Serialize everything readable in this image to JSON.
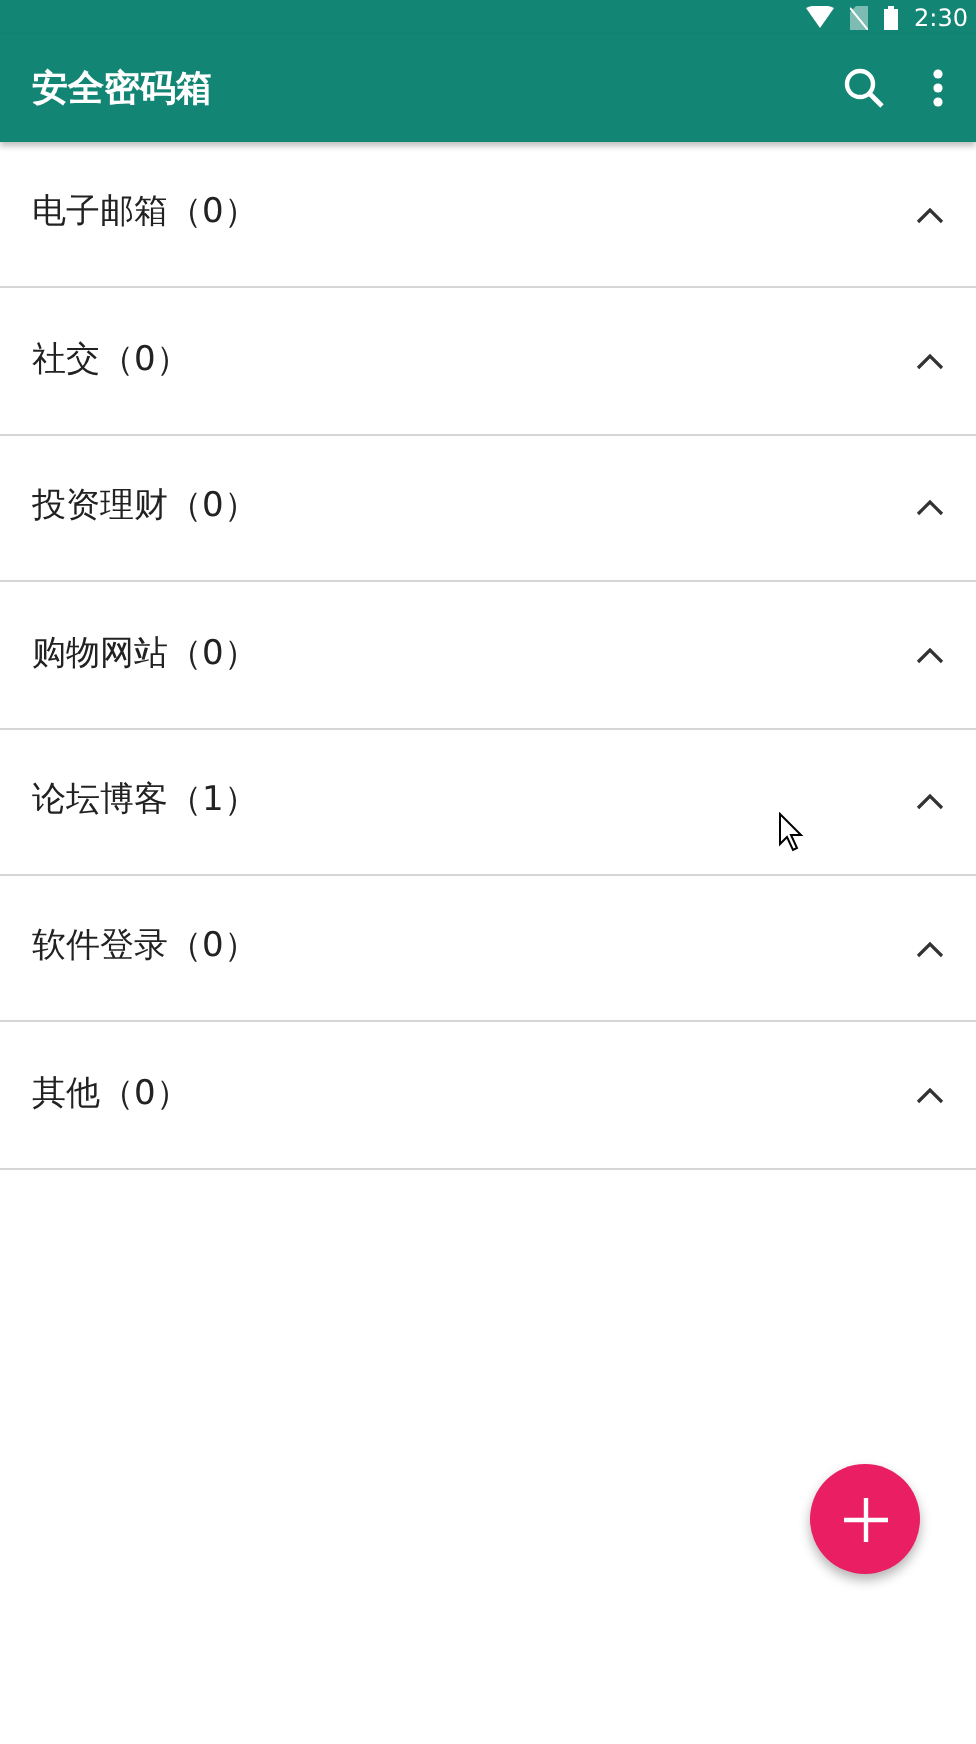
{
  "status_bar": {
    "time": "2:30"
  },
  "app_bar": {
    "title": "安全密码箱"
  },
  "categories": [
    {
      "label": "电子邮箱（0）"
    },
    {
      "label": "社交（0）"
    },
    {
      "label": "投资理财（0）"
    },
    {
      "label": "购物网站（0）"
    },
    {
      "label": "论坛博客（1）"
    },
    {
      "label": "软件登录（0）"
    },
    {
      "label": "其他（0）"
    }
  ]
}
